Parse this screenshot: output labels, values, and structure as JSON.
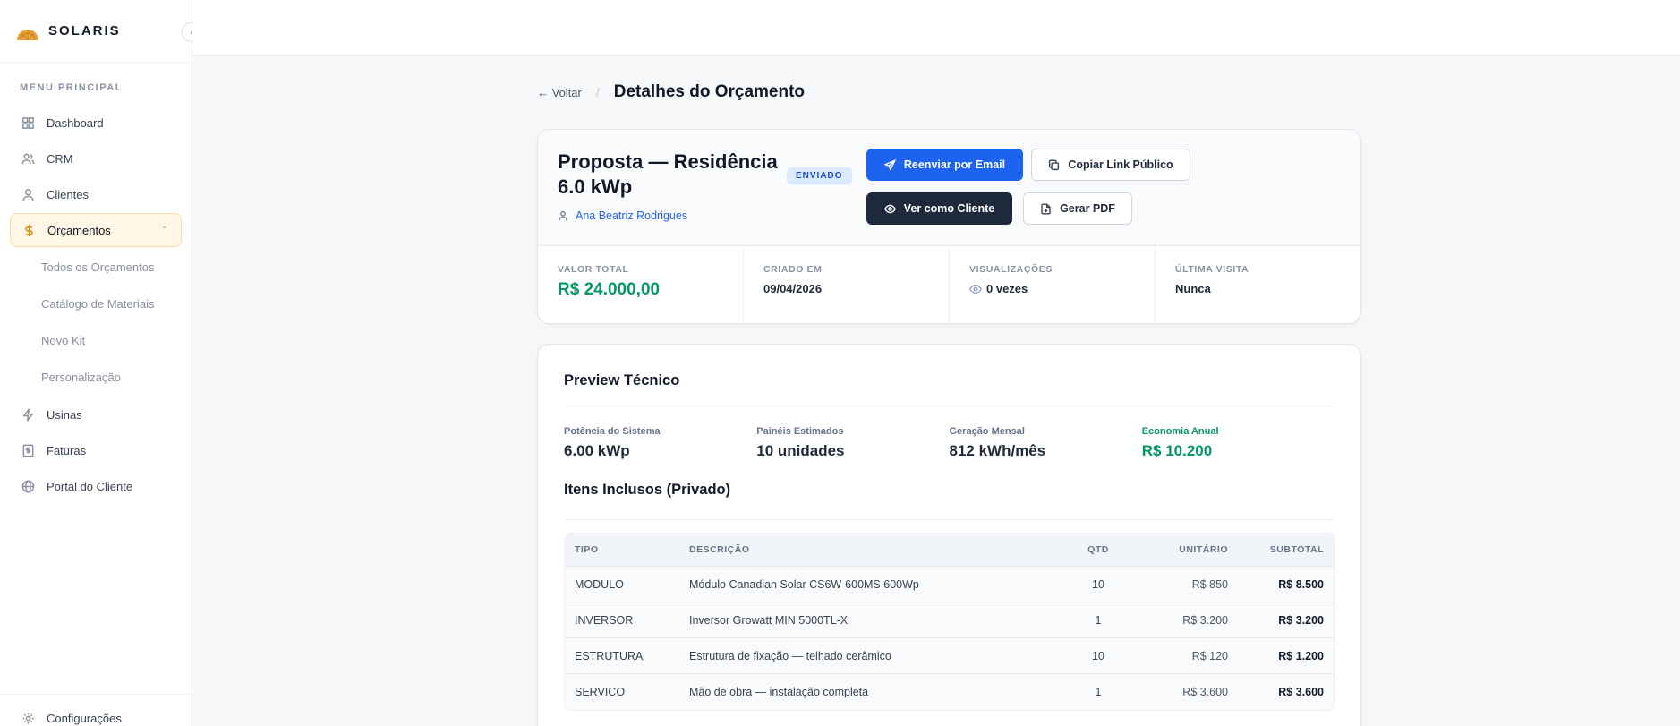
{
  "brand": {
    "name": "SOLARIS",
    "collapse_icon": "chevron-left-icon"
  },
  "sidebar": {
    "section_label": "MENU PRINCIPAL",
    "items": [
      {
        "label": "Dashboard",
        "icon": "grid-icon"
      },
      {
        "label": "CRM",
        "icon": "users-icon"
      },
      {
        "label": "Clientes",
        "icon": "user-icon"
      },
      {
        "label": "Orçamentos",
        "icon": "dollar-icon",
        "active": true,
        "expanded": true
      },
      {
        "label": "Usinas",
        "icon": "bolt-icon"
      },
      {
        "label": "Faturas",
        "icon": "invoice-icon"
      },
      {
        "label": "Portal do Cliente",
        "icon": "globe-icon"
      }
    ],
    "sub_items": [
      "Todos os Orçamentos",
      "Catálogo de Materiais",
      "Novo Kit",
      "Personalização"
    ],
    "footer_item": {
      "label": "Configurações",
      "icon": "gear-icon"
    }
  },
  "breadcrumb": {
    "back_label": "← Voltar",
    "separator": "/",
    "title": "Detalhes do Orçamento"
  },
  "quote": {
    "title": "Proposta — Residência 6.0 kWp",
    "status": "ENVIADO",
    "client_name": "Ana Beatriz Rodrigues",
    "buttons": {
      "resend": "Reenviar por Email",
      "copy_link": "Copiar Link Público",
      "view_as_client": "Ver como Cliente",
      "pdf": "Gerar PDF"
    },
    "stats": [
      {
        "label": "VALOR TOTAL",
        "value": "R$ 24.000,00"
      },
      {
        "label": "CRIADO EM",
        "value": "09/04/2026"
      },
      {
        "label": "VISUALIZAÇÕES",
        "value": "0 vezes"
      },
      {
        "label": "ÚLTIMA VISITA",
        "value": "Nunca"
      }
    ]
  },
  "preview": {
    "title": "Preview Técnico",
    "metrics": [
      {
        "label": "Potência do Sistema",
        "value": "6.00 kWp"
      },
      {
        "label": "Painéis Estimados",
        "value": "10 unidades"
      },
      {
        "label": "Geração Mensal",
        "value": "812 kWh/mês"
      },
      {
        "label": "Economia Anual",
        "value": "R$ 10.200"
      }
    ],
    "items_title": "Itens Inclusos (Privado)",
    "table": {
      "headers": [
        "TIPO",
        "DESCRIÇÃO",
        "QTD",
        "UNITÁRIO",
        "SUBTOTAL"
      ],
      "rows": [
        [
          "MODULO",
          "Módulo Canadian Solar CS6W-600MS 600Wp",
          "10",
          "R$ 850",
          "R$ 8.500"
        ],
        [
          "INVERSOR",
          "Inversor Growatt MIN 5000TL-X",
          "1",
          "R$ 3.200",
          "R$ 3.200"
        ],
        [
          "ESTRUTURA",
          "Estrutura de fixação — telhado cerâmico",
          "10",
          "R$ 120",
          "R$ 1.200"
        ],
        [
          "SERVICO",
          "Mão de obra — instalação completa",
          "1",
          "R$ 3.600",
          "R$ 3.600"
        ]
      ]
    }
  },
  "colors": {
    "accent": "#1d63f0",
    "success": "#059669",
    "active_bg": "#fff6e6",
    "dark_button": "#1e293b"
  }
}
